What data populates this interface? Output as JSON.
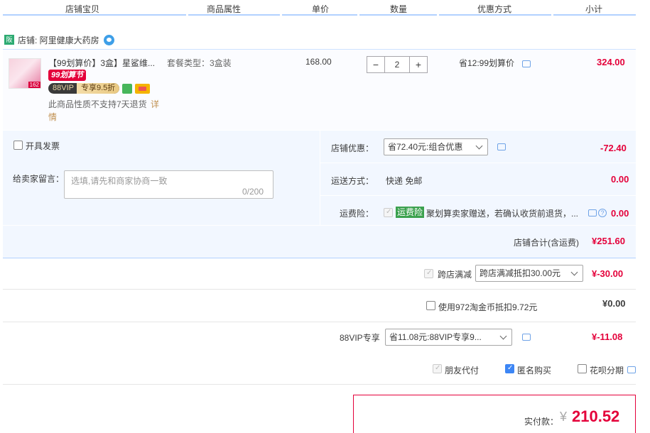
{
  "columns": [
    "店铺宝贝",
    "商品属性",
    "单价",
    "数量",
    "优惠方式",
    "小计"
  ],
  "shop": {
    "icon": "shop-icon",
    "icon_text": "阪",
    "name": "店铺: 阿里健康大药房"
  },
  "item": {
    "title": "【99划算价】3盒】星鲨维...",
    "attr": "套餐类型：3盒装",
    "price": "168.00",
    "qty": "2",
    "minus": "−",
    "plus": "+",
    "discount": "省12:99划算价",
    "subtotal": "324.00",
    "badge99": "99划算节",
    "vip_a": "88VIP",
    "vip_b": "专享9.5折",
    "return_note": "此商品性质不支持7天退货",
    "detail_a": "详",
    "detail_b": "情",
    "thumb_num": "162"
  },
  "invoice": {
    "label": "开具发票"
  },
  "memo": {
    "label": "给卖家留言：",
    "placeholder": "选填,请先和商家协商一致",
    "count": "0/200"
  },
  "shop_discount": {
    "label": "店铺优惠：",
    "value": "省72.40元:组合优惠",
    "amount": "-72.40"
  },
  "shipping": {
    "label": "运送方式：",
    "value": "快递 免邮",
    "amount": "0.00"
  },
  "insurance": {
    "label": "运费险：",
    "tag": "运费险",
    "value": "聚划算卖家赠送，若确认收货前退货，...",
    "amount": "0.00"
  },
  "shop_total": {
    "label": "店铺合计(含运费)",
    "amount": "¥251.60"
  },
  "cross_shop": {
    "label": "跨店满减",
    "value": "跨店满减抵扣30.00元",
    "amount": "¥-30.00"
  },
  "taojinbi": {
    "label": "使用972淘金币抵扣9.72元",
    "amount": "¥0.00"
  },
  "vip88": {
    "label": "88VIP专享",
    "value": "省11.08元:88VIP专享9...",
    "amount": "¥-11.08"
  },
  "options": {
    "friend_pay": "朋友代付",
    "anonymous": "匿名购买",
    "huabei": "花呗分期"
  },
  "pay": {
    "label": "实付款：",
    "currency": "¥",
    "amount": "210.52"
  }
}
